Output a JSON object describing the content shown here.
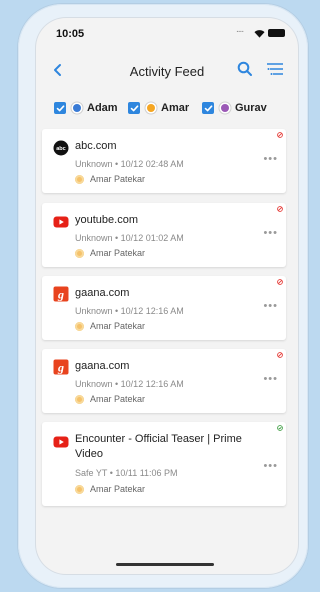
{
  "status_bar": {
    "time": "10:05",
    "dots": "...."
  },
  "header": {
    "title": "Activity Feed"
  },
  "filters": [
    {
      "label": "Adam",
      "avatar_color": "#3a7bd5"
    },
    {
      "label": "Amar",
      "avatar_color": "#f5a623"
    },
    {
      "label": "Gurav",
      "avatar_color": "#9b59b6"
    }
  ],
  "feed": [
    {
      "title": "abc.com",
      "meta": "Unknown • 10/12 02:48 AM",
      "user": "Amar Patekar",
      "icon": "abc-logo-icon",
      "status": "blocked",
      "menu": "•••"
    },
    {
      "title": "youtube.com",
      "meta": "Unknown • 10/12 01:02 AM",
      "user": "Amar Patekar",
      "icon": "youtube-logo-icon",
      "status": "blocked",
      "menu": "•••"
    },
    {
      "title": "gaana.com",
      "meta": "Unknown • 10/12 12:16 AM",
      "user": "Amar Patekar",
      "icon": "gaana-logo-icon",
      "status": "blocked",
      "menu": "•••"
    },
    {
      "title": "gaana.com",
      "meta": "Unknown • 10/12 12:16 AM",
      "user": "Amar Patekar",
      "icon": "gaana-logo-icon",
      "status": "blocked",
      "menu": "•••"
    },
    {
      "title": "Encounter - Official Teaser | Prime Video",
      "meta": "Safe YT • 10/11 11:06 PM",
      "user": "Amar Patekar",
      "icon": "youtube-logo-icon",
      "status": "safe",
      "menu": "•••"
    }
  ],
  "colors": {
    "accent": "#2e86de",
    "blocked": "#e53935",
    "safe": "#43a047",
    "youtube": "#e62117",
    "gaana": "#e8431e"
  }
}
